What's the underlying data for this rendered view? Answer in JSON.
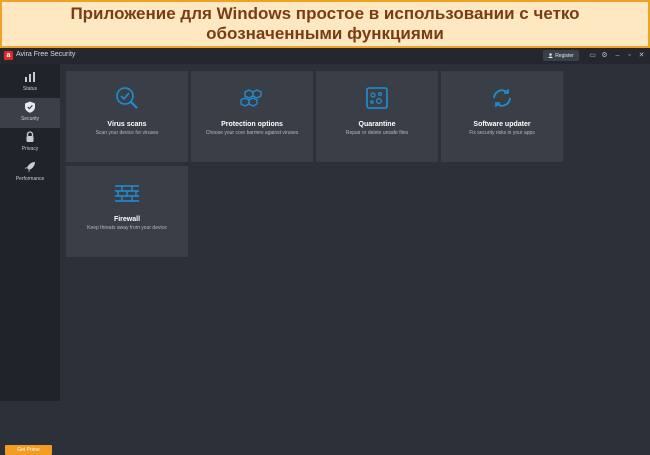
{
  "banner": {
    "text": "Приложение для Windows простое в использовании с четко обозначенными функциями"
  },
  "window": {
    "title": "Avira  Free Security",
    "register_label": "Register"
  },
  "sidebar": {
    "items": [
      {
        "label": "Status",
        "icon": "bars-icon"
      },
      {
        "label": "Security",
        "icon": "shield-icon"
      },
      {
        "label": "Privacy",
        "icon": "lock-icon"
      },
      {
        "label": "Performance",
        "icon": "rocket-icon"
      }
    ],
    "cta_label": "Get Prime"
  },
  "tiles": [
    {
      "title": "Virus scans",
      "desc": "Scan your device for viruses",
      "icon": "magnifier-check-icon"
    },
    {
      "title": "Protection options",
      "desc": "Choose your core barriers against viruses",
      "icon": "hexagons-icon"
    },
    {
      "title": "Quarantine",
      "desc": "Repair or delete unsafe files",
      "icon": "quarantine-box-icon"
    },
    {
      "title": "Software updater",
      "desc": "Fix security risks in your apps",
      "icon": "refresh-icon"
    },
    {
      "title": "Firewall",
      "desc": "Keep threats away from your device",
      "icon": "brick-wall-icon"
    }
  ],
  "colors": {
    "accent": "#1e8fd6",
    "cta": "#f29c23",
    "banner_border": "#f0a224",
    "banner_text": "#7a3d12"
  }
}
